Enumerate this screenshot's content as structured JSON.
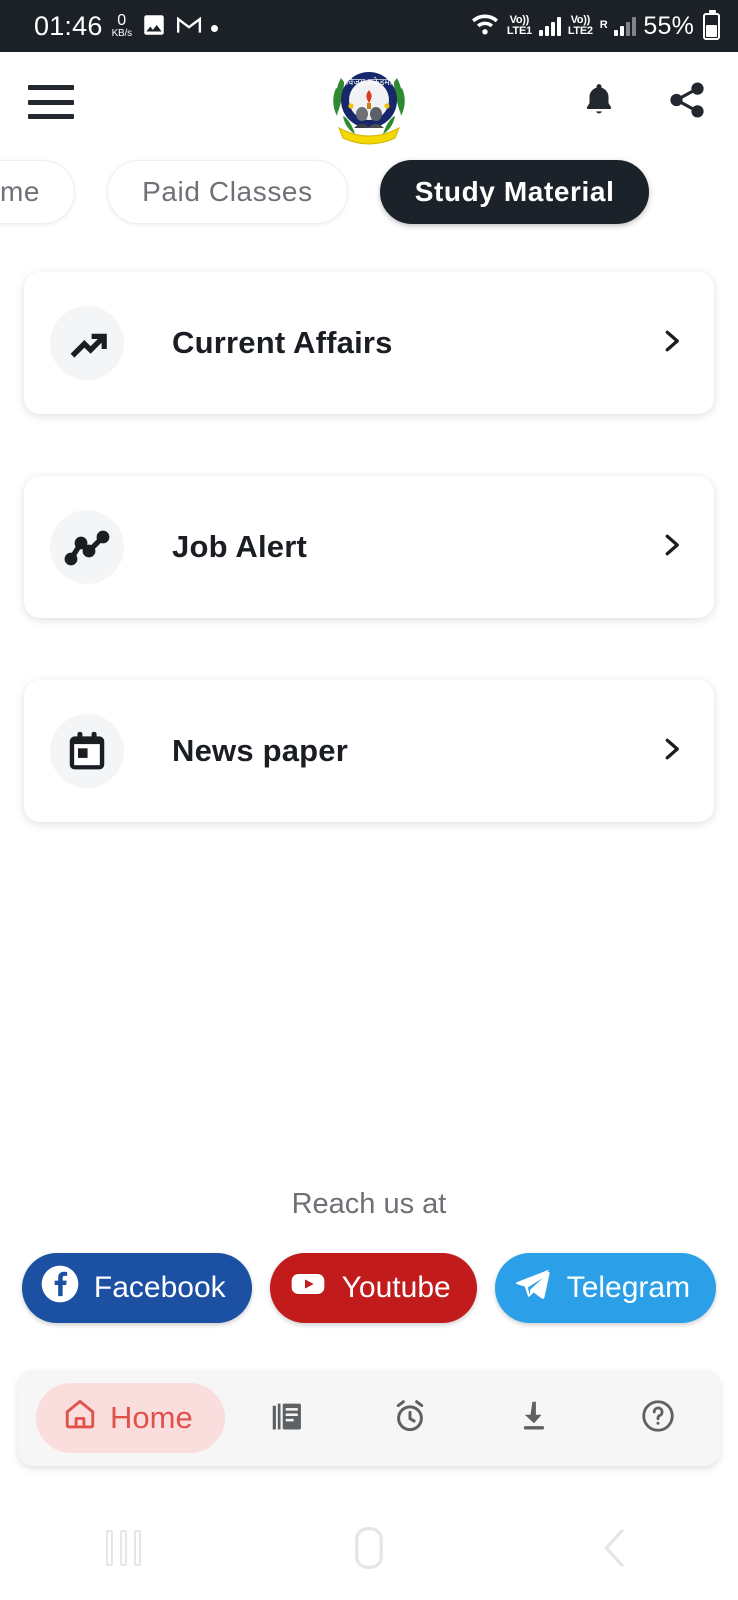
{
  "status_bar": {
    "time": "01:46",
    "data_speed_value": "0",
    "data_speed_unit": "KB/s",
    "icons": [
      "image-icon",
      "gmail-icon",
      "dot-indicator",
      "wifi-icon"
    ],
    "sim1_label": "Vo))",
    "sim1_network": "LTE1",
    "sim2_label": "Vo))",
    "sim2_network": "LTE2",
    "roaming_label": "R",
    "battery_percent": "55%"
  },
  "header": {
    "menu_icon": "hamburger-menu-icon",
    "logo_alt": "vijay-academy-logo",
    "logo_text": "विजय एकेडमी",
    "notification_icon": "bell-icon",
    "share_icon": "share-icon"
  },
  "tabs": [
    {
      "label": "Home",
      "active": false
    },
    {
      "label": "Paid Classes",
      "active": false
    },
    {
      "label": "Study Material",
      "active": true
    }
  ],
  "study_material_items": [
    {
      "label": "Current Affairs",
      "icon": "trending-up-icon",
      "chevron": "chevron-right-icon"
    },
    {
      "label": "Job Alert",
      "icon": "line-chart-icon",
      "chevron": "chevron-right-icon"
    },
    {
      "label": "News paper",
      "icon": "calendar-icon",
      "chevron": "chevron-right-icon"
    }
  ],
  "footer": {
    "reach_us_label": "Reach us at",
    "socials": [
      {
        "label": "Facebook",
        "icon": "facebook-icon",
        "color": "#1b50a2"
      },
      {
        "label": "Youtube",
        "icon": "youtube-icon",
        "color": "#c11b1b"
      },
      {
        "label": "Telegram",
        "icon": "telegram-icon",
        "color": "#2ba0e8"
      }
    ]
  },
  "bottom_nav": [
    {
      "label": "Home",
      "icon": "home-icon",
      "active": true
    },
    {
      "label": "",
      "icon": "library-books-icon",
      "active": false
    },
    {
      "label": "",
      "icon": "alarm-clock-icon",
      "active": false
    },
    {
      "label": "",
      "icon": "download-icon",
      "active": false
    },
    {
      "label": "",
      "icon": "help-circle-icon",
      "active": false
    }
  ],
  "android_nav": [
    {
      "icon": "recents-icon"
    },
    {
      "icon": "home-button-icon"
    },
    {
      "icon": "back-icon"
    }
  ],
  "colors": {
    "active_tab_bg": "#1c2229",
    "accent_red": "#e0514c",
    "accent_pill_bg": "#fadedd",
    "status_bar_bg": "#1b2126"
  }
}
